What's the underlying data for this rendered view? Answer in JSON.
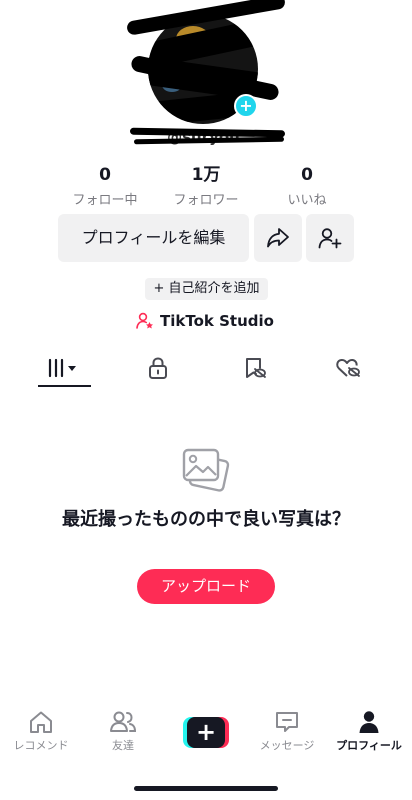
{
  "profile": {
    "username": "@suryou...",
    "add_badge": "+"
  },
  "stats": [
    {
      "value": "0",
      "label": "フォロー中"
    },
    {
      "value": "1万",
      "label": "フォロワー"
    },
    {
      "value": "0",
      "label": "いいね"
    }
  ],
  "actions": {
    "edit_profile": "プロフィールを編集",
    "add_bio": "+ 自己紹介を追加",
    "studio": "TikTok Studio"
  },
  "tabs": [
    {
      "icon": "grid-icon",
      "active": true
    },
    {
      "icon": "lock-icon",
      "active": false
    },
    {
      "icon": "bookmark-hidden-icon",
      "active": false
    },
    {
      "icon": "heart-hidden-icon",
      "active": false
    }
  ],
  "empty_state": {
    "title": "最近撮ったものの中で良い写真は？",
    "button": "アップロード"
  },
  "nav": [
    {
      "label": "レコメンド",
      "icon": "home-icon"
    },
    {
      "label": "友達",
      "icon": "friends-icon"
    },
    {
      "label": "",
      "icon": "create-plus-icon"
    },
    {
      "label": "メッセージ",
      "icon": "inbox-icon"
    },
    {
      "label": "プロフィール",
      "icon": "profile-icon",
      "active": true
    }
  ],
  "colors": {
    "accent": "#fe2c55",
    "cyan": "#25f4ee",
    "text": "#161823",
    "muted": "#8a8b91",
    "button_bg": "#f1f1f2"
  }
}
